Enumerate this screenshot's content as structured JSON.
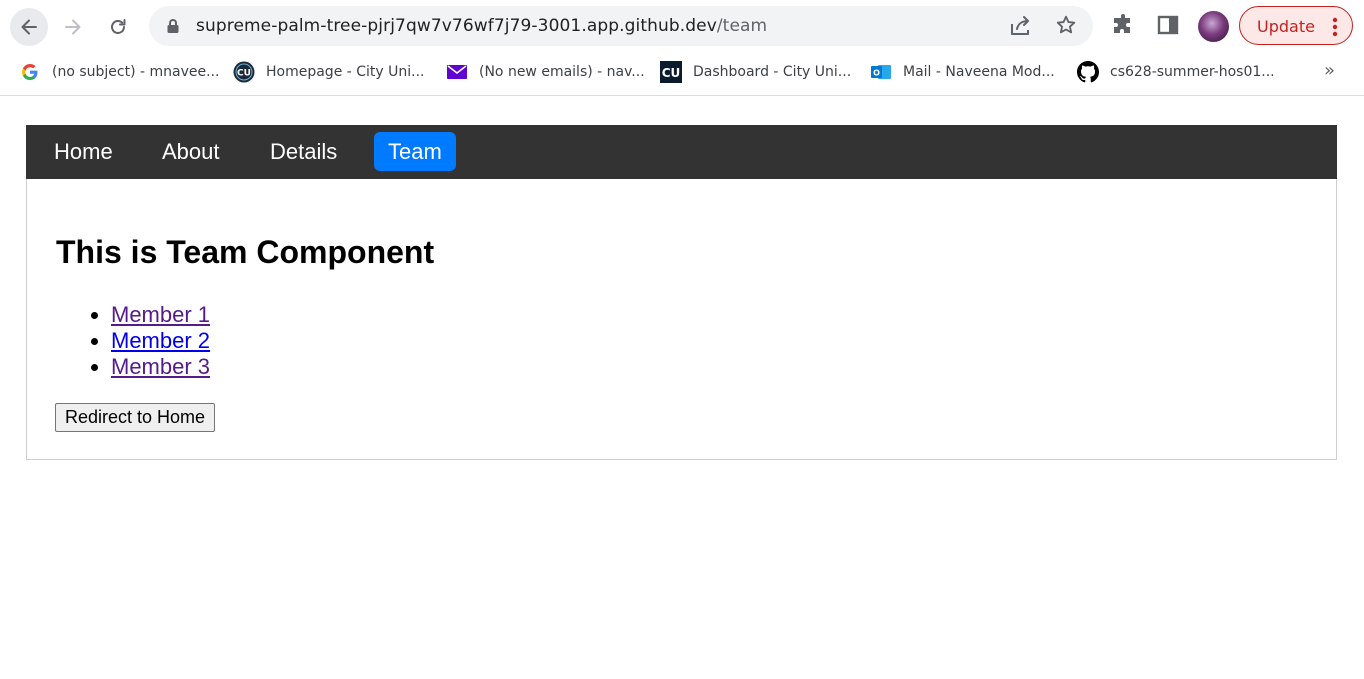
{
  "browser": {
    "url_host": "supreme-palm-tree-pjrj7qw7v76wf7j79-3001.app.github.dev",
    "url_path": "/team",
    "update_label": "Update",
    "bookmarks": [
      {
        "icon": "google-icon",
        "label": "(no subject) - mnavee..."
      },
      {
        "icon": "cityu-icon",
        "label": "Homepage - City Uni..."
      },
      {
        "icon": "mail-icon",
        "label": "(No new emails) - nav..."
      },
      {
        "icon": "cu-icon",
        "label": "Dashboard - City Uni..."
      },
      {
        "icon": "outlook-icon",
        "label": "Mail - Naveena Mod..."
      },
      {
        "icon": "github-icon",
        "label": "cs628-summer-hos01..."
      }
    ],
    "bookmarks_more": "»",
    "colors": {
      "update_accent": "#c5221f",
      "omnibox_bg": "#f1f3f4"
    }
  },
  "navbar": {
    "links": [
      {
        "label": "Home",
        "active": false
      },
      {
        "label": "About",
        "active": false
      },
      {
        "label": "Details",
        "active": false
      },
      {
        "label": "Team",
        "active": true
      }
    ],
    "colors": {
      "bar": "#333333",
      "active": "#007bff"
    }
  },
  "main": {
    "heading": "This is Team Component",
    "members": [
      {
        "label": "Member 1",
        "visited": true
      },
      {
        "label": "Member 2",
        "visited": false
      },
      {
        "label": "Member 3",
        "visited": true
      }
    ],
    "redirect_button": "Redirect to Home"
  }
}
